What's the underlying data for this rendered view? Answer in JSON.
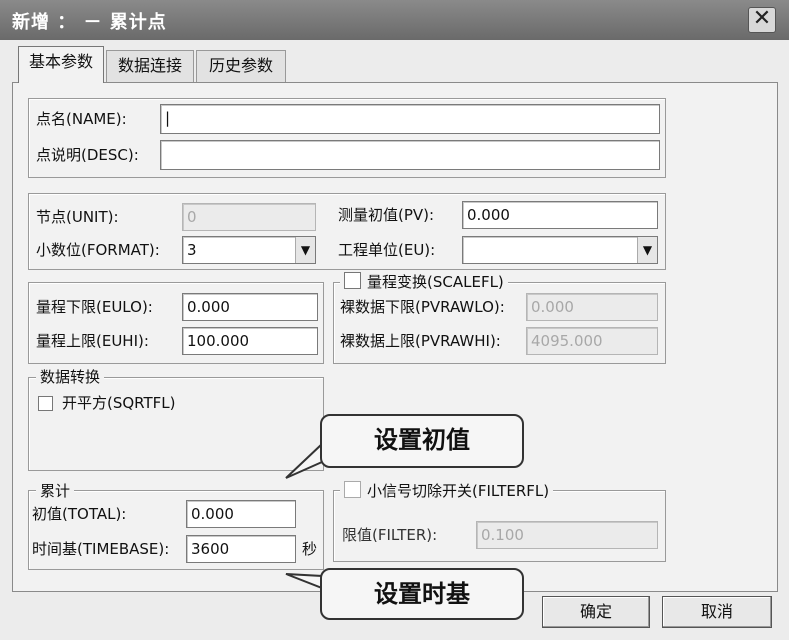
{
  "window": {
    "title": "新增 ： － 累计点",
    "close_glyph": "✕"
  },
  "tabs": [
    {
      "label": "基本参数",
      "active": true
    },
    {
      "label": "数据连接",
      "active": false
    },
    {
      "label": "历史参数",
      "active": false
    }
  ],
  "name_group": {
    "name_label": "点名(NAME):",
    "name_value": "|",
    "desc_label": "点说明(DESC):",
    "desc_value": ""
  },
  "node_group": {
    "unit_label": "节点(UNIT):",
    "unit_value": "0",
    "format_label": "小数位(FORMAT):",
    "format_value": "3",
    "pv_label": "测量初值(PV):",
    "pv_value": "0.000",
    "eu_label": "工程单位(EU):",
    "eu_value": ""
  },
  "range_group": {
    "eulo_label": "量程下限(EULO):",
    "eulo_value": "0.000",
    "euhi_label": "量程上限(EUHI):",
    "euhi_value": "100.000"
  },
  "scale_group": {
    "legend": "量程变换(SCALEFL)",
    "pvrawlo_label": "裸数据下限(PVRAWLO):",
    "pvrawlo_value": "0.000",
    "pvrawhi_label": "裸数据上限(PVRAWHI):",
    "pvrawhi_value": "4095.000"
  },
  "convert_group": {
    "legend": "数据转换",
    "sqrt_label": "开平方(SQRTFL)"
  },
  "total_group": {
    "legend": "累计",
    "total_label": "初值(TOTAL):",
    "total_value": "0.000",
    "timebase_label": "时间基(TIMEBASE):",
    "timebase_value": "3600",
    "timebase_unit": "秒"
  },
  "filter_group": {
    "legend": "小信号切除开关(FILTERFL)",
    "filter_label": "限值(FILTER):",
    "filter_value": "0.100"
  },
  "callouts": {
    "initial": "设置初值",
    "timebase": "设置时基"
  },
  "buttons": {
    "ok": "确定",
    "cancel": "取消"
  }
}
